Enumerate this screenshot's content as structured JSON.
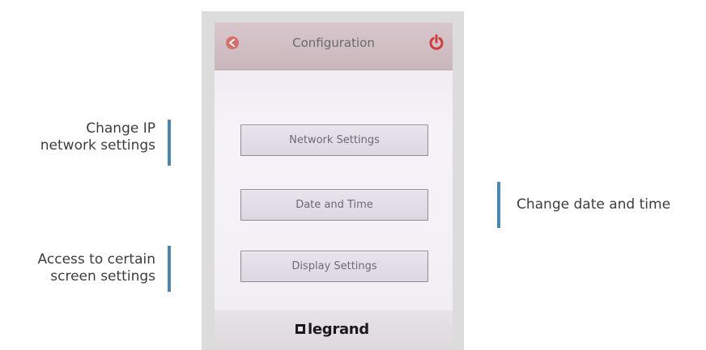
{
  "callouts": {
    "network": "Change IP\nnetwork settings",
    "display": "Access to certain\nscreen settings",
    "datetime": "Change date and time"
  },
  "device": {
    "title": "Configuration",
    "back_icon": "back-arrow-icon",
    "power_icon": "power-icon",
    "buttons": {
      "network": "Network Settings",
      "datetime": "Date and Time",
      "display": "Display Settings"
    },
    "brand": "legrand"
  },
  "colors": {
    "callout_bar": "#4a86b4",
    "icon_red": "#d23b3b"
  }
}
